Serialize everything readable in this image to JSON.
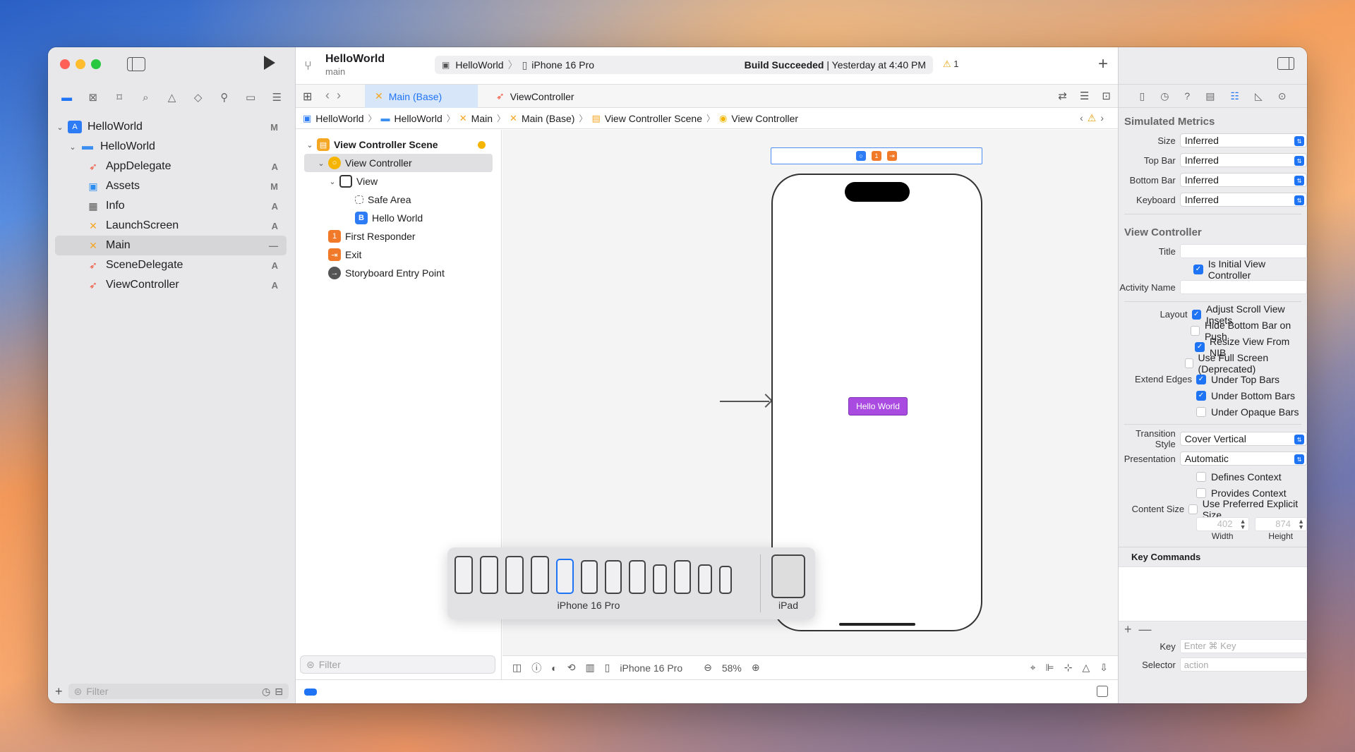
{
  "toolbar": {
    "project_title": "HelloWorld",
    "branch": "main",
    "scheme_target": "HelloWorld",
    "scheme_device": "iPhone 16 Pro",
    "build_status_bold": "Build Succeeded",
    "build_status_time": " | Yesterday at 4:40 PM",
    "warning_count": "1"
  },
  "navigator": {
    "items": [
      {
        "label": "HelloWorld",
        "badge": "M"
      },
      {
        "label": "HelloWorld",
        "badge": ""
      },
      {
        "label": "AppDelegate",
        "badge": "A"
      },
      {
        "label": "Assets",
        "badge": "M"
      },
      {
        "label": "Info",
        "badge": "A"
      },
      {
        "label": "LaunchScreen",
        "badge": "A"
      },
      {
        "label": "Main",
        "badge": "—"
      },
      {
        "label": "SceneDelegate",
        "badge": "A"
      },
      {
        "label": "ViewController",
        "badge": "A"
      }
    ],
    "filter_placeholder": "Filter"
  },
  "tabs": {
    "active": "Main (Base)",
    "other": "ViewController"
  },
  "jumpbar": [
    "HelloWorld",
    "HelloWorld",
    "Main",
    "Main (Base)",
    "View Controller Scene",
    "View Controller"
  ],
  "outline": {
    "items": [
      "View Controller Scene",
      "View Controller",
      "View",
      "Safe Area",
      "Hello World",
      "First Responder",
      "Exit",
      "Storyboard Entry Point"
    ],
    "filter_placeholder": "Filter"
  },
  "canvas": {
    "button_label": "Hello World",
    "device_label": "iPhone 16 Pro",
    "ipad_label": "iPad",
    "bottom_device": "iPhone 16 Pro",
    "zoom": "58%"
  },
  "inspector": {
    "simulated_title": "Simulated Metrics",
    "size_label": "Size",
    "size_value": "Inferred",
    "topbar_label": "Top Bar",
    "topbar_value": "Inferred",
    "bottombar_label": "Bottom Bar",
    "bottombar_value": "Inferred",
    "keyboard_label": "Keyboard",
    "keyboard_value": "Inferred",
    "vc_title": "View Controller",
    "title_label": "Title",
    "is_initial": "Is Initial View Controller",
    "activity_label": "Activity Name",
    "layout_label": "Layout",
    "adjust_scroll": "Adjust Scroll View Insets",
    "hide_bottom": "Hide Bottom Bar on Push",
    "resize_nib": "Resize View From NIB",
    "full_screen": "Use Full Screen (Deprecated)",
    "extend_label": "Extend Edges",
    "under_top": "Under Top Bars",
    "under_bottom": "Under Bottom Bars",
    "under_opaque": "Under Opaque Bars",
    "transition_label": "Transition Style",
    "transition_value": "Cover Vertical",
    "presentation_label": "Presentation",
    "presentation_value": "Automatic",
    "defines_context": "Defines Context",
    "provides_context": "Provides Context",
    "content_size_label": "Content Size",
    "preferred_size": "Use Preferred Explicit Size",
    "width_value": "402",
    "height_value": "874",
    "width_label": "Width",
    "height_label": "Height",
    "key_commands_title": "Key Commands",
    "key_label": "Key",
    "key_placeholder": "Enter ⌘ Key",
    "selector_label": "Selector",
    "selector_placeholder": "action"
  }
}
